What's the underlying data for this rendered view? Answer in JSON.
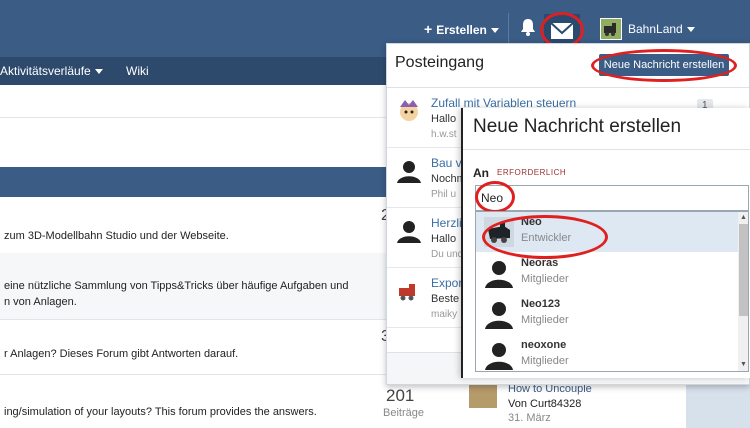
{
  "header": {
    "create_label": "Erstellen",
    "user_name": "BahnLand"
  },
  "nav": {
    "activity_label": "Aktivitätsverläufe",
    "wiki_label": "Wiki"
  },
  "background": {
    "row1_text": "zum 3D-Modellbahn Studio und der Webseite.",
    "row1_num": "2",
    "row2_text_a": "eine nützliche Sammlung von Tipps&Tricks über häufige Aufgaben und",
    "row2_text_b": "n von Anlagen.",
    "row3_text": "r Anlagen? Dieses Forum gibt Antworten darauf.",
    "row3_num": "3",
    "row4_text": "ing/simulation of your layouts? This forum provides the answers.",
    "row4_num": "201",
    "row4_label": "Beiträge",
    "row4_link": "How to Uncouple",
    "row4_by": "Von Curt84328",
    "row4_date": "31. März"
  },
  "inbox": {
    "title": "Posteingang",
    "new_message_label": "Neue Nachricht erstellen",
    "items": [
      {
        "subject": "Zufall mit Variablen steuern",
        "preview": "Hallo",
        "meta": "h.w.st",
        "badge": "1"
      },
      {
        "subject": "Bau v",
        "preview": "Nochm",
        "meta": "Phil u"
      },
      {
        "subject": "Herzli",
        "preview": "Hallo",
        "meta": "Du und"
      },
      {
        "subject": "Expor",
        "preview": "Beste",
        "meta": "maiky"
      }
    ]
  },
  "compose": {
    "title": "Neue Nachricht erstellen",
    "to_label": "An",
    "required_label": "ERFORDERLICH",
    "to_value": "Neo",
    "suggestions": [
      {
        "name": "Neo",
        "role": "Entwickler"
      },
      {
        "name": "Neoras",
        "role": "Mitglieder"
      },
      {
        "name": "Neo123",
        "role": "Mitglieder"
      },
      {
        "name": "neoxone",
        "role": "Mitglieder"
      }
    ]
  }
}
